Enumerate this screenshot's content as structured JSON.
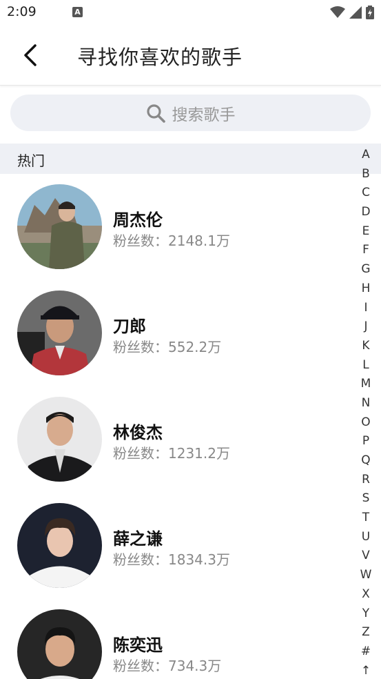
{
  "status_bar": {
    "time": "2:09",
    "notification_icon": "A",
    "icons": [
      "wifi-icon",
      "signal-icon",
      "battery-charging-icon"
    ]
  },
  "header": {
    "back_icon": "chevron-left-icon",
    "title": "寻找你喜欢的歌手"
  },
  "search": {
    "icon": "search-icon",
    "placeholder": "搜索歌手"
  },
  "section": {
    "title": "热门"
  },
  "artists": [
    {
      "name": "周杰伦",
      "fans": "粉丝数：2148.1万"
    },
    {
      "name": "刀郎",
      "fans": "粉丝数：552.2万"
    },
    {
      "name": "林俊杰",
      "fans": "粉丝数：1231.2万"
    },
    {
      "name": "薛之谦",
      "fans": "粉丝数：1834.3万"
    },
    {
      "name": "陈奕迅",
      "fans": "粉丝数：734.3万"
    }
  ],
  "alpha_index": [
    "A",
    "B",
    "C",
    "D",
    "E",
    "F",
    "G",
    "H",
    "I",
    "J",
    "K",
    "L",
    "M",
    "N",
    "O",
    "P",
    "Q",
    "R",
    "S",
    "T",
    "U",
    "V",
    "W",
    "X",
    "Y",
    "Z",
    "#",
    "↑"
  ]
}
